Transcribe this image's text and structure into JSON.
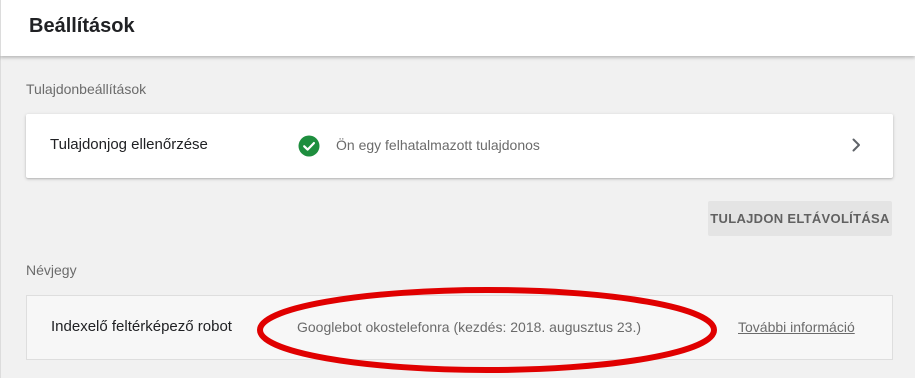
{
  "header": {
    "title": "Beállítások"
  },
  "property_settings": {
    "section_label": "Tulajdonbeállítások",
    "ownership": {
      "label": "Tulajdonjog ellenőrzése",
      "status_text": "Ön egy felhatalmazott tulajdonos",
      "status_icon": "check-circle-icon",
      "status_color": "#1e8e3e",
      "action_icon": "chevron-right-icon"
    },
    "remove_button_label": "TULAJDON ELTÁVOLÍTÁSA"
  },
  "about": {
    "section_label": "Névjegy",
    "crawler": {
      "label": "Indexelő feltérképező robot",
      "value": "Googlebot okostelefonra (kezdés: 2018. augusztus 23.)",
      "link_text": "További információ"
    }
  },
  "annotation": {
    "shape": "ellipse",
    "color": "#e00000"
  }
}
